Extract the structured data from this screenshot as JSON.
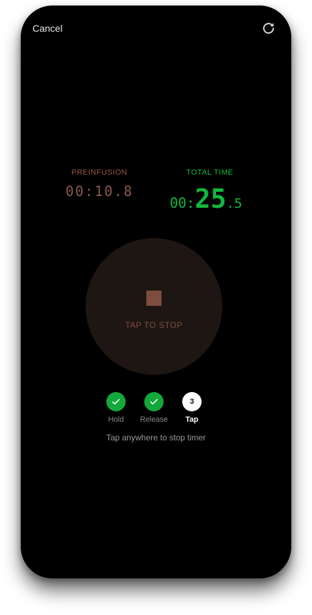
{
  "header": {
    "cancel_label": "Cancel",
    "reset_icon": "refresh-icon"
  },
  "preinfusion": {
    "label": "PREINFUSION",
    "time": "00:10.8"
  },
  "total_time": {
    "label": "TOTAL TIME",
    "minutes": "00:",
    "seconds": "25",
    "tenths": ".5"
  },
  "stop_button": {
    "label": "TAP TO STOP",
    "icon": "stop-icon"
  },
  "steps": [
    {
      "label": "Hold",
      "state": "done",
      "icon": "check-icon"
    },
    {
      "label": "Release",
      "state": "done",
      "icon": "check-icon"
    },
    {
      "label": "Tap",
      "state": "current",
      "number": "3"
    }
  ],
  "hint": "Tap anywhere to stop timer",
  "colors": {
    "background": "#000000",
    "accent_green": "#12b83e",
    "preinfusion_brown": "#8a5a4c",
    "stop_circle": "#1e1612"
  }
}
